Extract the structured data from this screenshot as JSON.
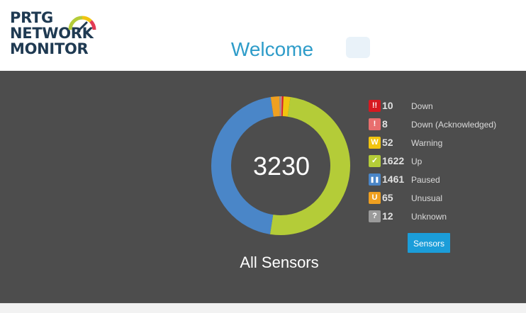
{
  "logo": {
    "line1": "PRTG",
    "line2": "NETWORK",
    "line3": "MONITOR"
  },
  "header": {
    "title": "Welcome"
  },
  "summary": {
    "total": "3230",
    "caption": "All Sensors"
  },
  "legend": [
    {
      "symbol": "!!",
      "count": "10",
      "label": "Down",
      "color": "#d71920"
    },
    {
      "symbol": "!",
      "count": "8",
      "label": "Down (Acknowledged)",
      "color": "#e86e6e"
    },
    {
      "symbol": "W",
      "count": "52",
      "label": "Warning",
      "color": "#f1c40f"
    },
    {
      "symbol": "✓",
      "count": "1622",
      "label": "Up",
      "color": "#b4cc38"
    },
    {
      "symbol": "❚❚",
      "count": "1461",
      "label": "Paused",
      "color": "#4a86c8"
    },
    {
      "symbol": "U",
      "count": "65",
      "label": "Unusual",
      "color": "#f0a020"
    },
    {
      "symbol": "?",
      "count": "12",
      "label": "Unknown",
      "color": "#9a9a9a"
    }
  ],
  "buttons": {
    "sensors": "Sensors"
  },
  "colors": {
    "accent": "#1b9dd9",
    "title": "#2e9cc9",
    "panel": "#4d4d4d"
  }
}
